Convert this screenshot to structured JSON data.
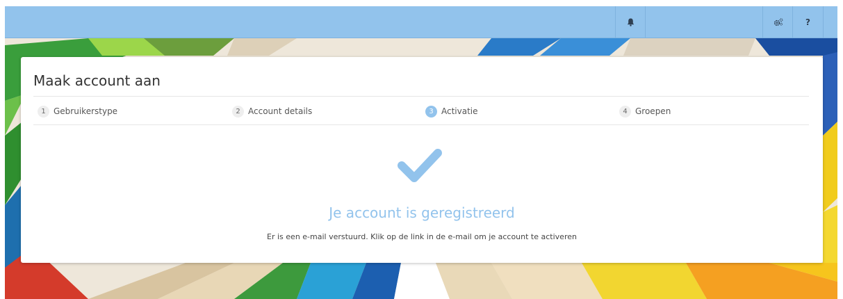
{
  "topbar": {
    "bell_icon": "bell-icon",
    "settings_icon": "gears-icon",
    "help_label": "?",
    "color": "#92c3ec"
  },
  "card": {
    "title": "Maak account aan",
    "steps": [
      {
        "number": "1",
        "label": "Gebruikerstype",
        "active": false
      },
      {
        "number": "2",
        "label": "Account details",
        "active": false
      },
      {
        "number": "3",
        "label": "Activatie",
        "active": true
      },
      {
        "number": "4",
        "label": "Groepen",
        "active": false
      }
    ],
    "success_icon": "checkmark-icon",
    "success_title": "Je account is geregistreerd",
    "success_message": "Er is een e-mail verstuurd. Klik op de link in de e-mail om je account te activeren",
    "accent_color": "#92c3ec"
  }
}
